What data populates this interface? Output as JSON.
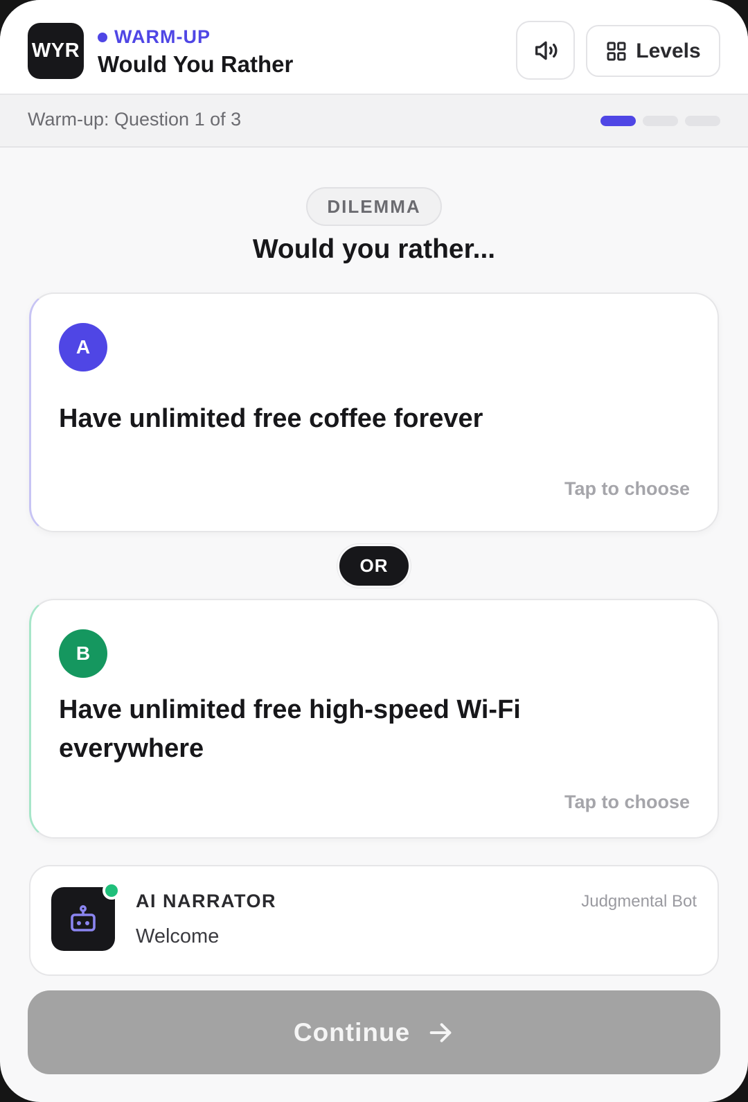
{
  "header": {
    "logo_text": "WYR",
    "stage_label": "WARM-UP",
    "title": "Would You Rather",
    "sound_icon": "speaker-icon",
    "levels_icon": "grid-icon",
    "levels_label": "Levels",
    "accent_color": "#4f46e5"
  },
  "progress": {
    "text": "Warm-up: Question 1 of 3",
    "current": 1,
    "total": 3
  },
  "dilemma": {
    "badge": "DILEMMA",
    "question": "Would you rather..."
  },
  "options": [
    {
      "letter": "A",
      "text": "Have unlimited free coffee forever",
      "hint": "Tap to choose",
      "color": "#4f46e5"
    },
    {
      "letter": "B",
      "text": "Have unlimited free high-speed Wi-Fi everywhere",
      "hint": "Tap to choose",
      "color": "#15975f"
    }
  ],
  "or_label": "OR",
  "narrator": {
    "icon": "robot-icon",
    "title": "AI NARRATOR",
    "persona": "Judgmental Bot",
    "message": "Welcome",
    "status_color": "#1fbf7a"
  },
  "continue": {
    "label": "Continue",
    "icon": "arrow-right-icon",
    "enabled": false
  }
}
